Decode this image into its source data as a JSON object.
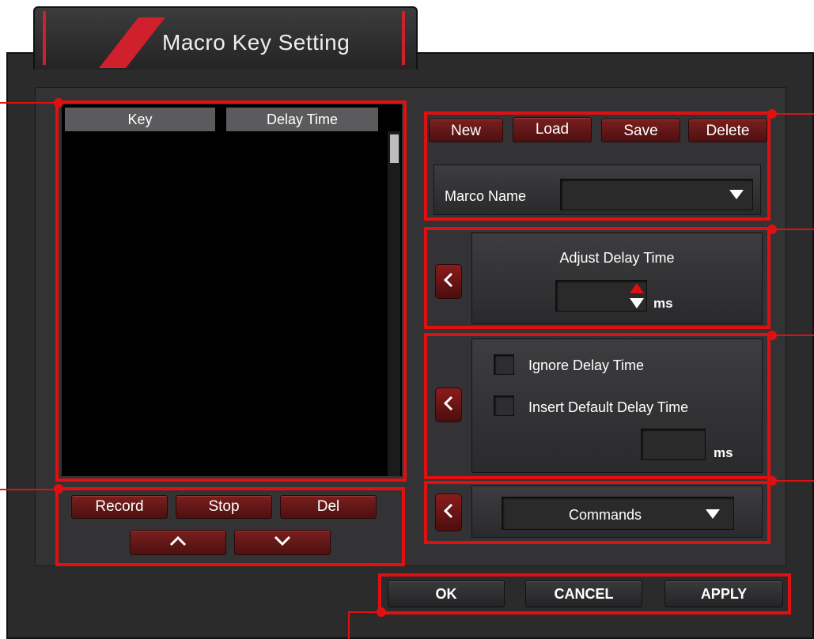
{
  "title": "Macro Key Setting",
  "list": {
    "col_key": "Key",
    "col_delay": "Delay Time"
  },
  "file_buttons": {
    "new": "New",
    "load": "Load",
    "save": "Save",
    "delete": "Delete"
  },
  "macro_name": {
    "label": "Marco Name",
    "value": ""
  },
  "adjust": {
    "title": "Adjust Delay Time",
    "value": "",
    "unit": "ms"
  },
  "options": {
    "ignore": "Ignore Delay Time",
    "insert_default": "Insert Default Delay Time",
    "default_value": "",
    "unit": "ms"
  },
  "commands": {
    "label": "Commands"
  },
  "record_buttons": {
    "record": "Record",
    "stop": "Stop",
    "del": "Del"
  },
  "footer": {
    "ok": "OK",
    "cancel": "CANCEL",
    "apply": "APPLY"
  },
  "colors": {
    "accent": "#e01010",
    "button_red": "#7a1f1f",
    "panel": "#2b2b2c"
  },
  "icons": {
    "up": "chevron-up-icon",
    "down": "chevron-down-icon",
    "back": "chevron-left-icon",
    "dropdown": "triangle-down-icon"
  }
}
